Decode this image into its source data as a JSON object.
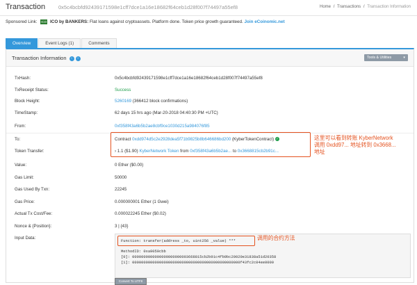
{
  "header": {
    "title": "Transaction",
    "hash": "0x5c4bcbfd92439171598e1cff7dce1a16e18682f64ceb1d28f007f74497a55ef8",
    "breadcrumbs": [
      "Home",
      "Transactions",
      "Transaction Information"
    ],
    "separator": "/"
  },
  "sponsor": {
    "prefix": "Sponsored Link:",
    "logo_text": "ICO",
    "brand": "ICO by BANKERS:",
    "text": "Flat loans against cryptoassets. Platform done. Token price growth guaranteed.",
    "link": "Join eCoinomic.net"
  },
  "tabs": [
    {
      "label": "Overview",
      "active": true
    },
    {
      "label": "Event Logs (1)",
      "active": false
    },
    {
      "label": "Comments",
      "active": false
    }
  ],
  "panel": {
    "title": "Transaction Information",
    "tools_label": "Tools & Utilities",
    "caret": "▾",
    "prev_icon": "‹",
    "next_icon": "›"
  },
  "fields": {
    "txhash": {
      "label": "TxHash:",
      "value": "0x5c4bcbfd92439171598e1cff7dce1a16e18682f64ceb1d28f007f74497a55ef8"
    },
    "receipt": {
      "label": "TxReceipt Status:",
      "value": "Success"
    },
    "block": {
      "label": "Block Height:",
      "value": "5260169",
      "extra": "(366412 block confirmations)"
    },
    "timestamp": {
      "label": "TimeStamp:",
      "value": "62 days 15 hrs ago (Mar-20-2018 04:40:30 PM +UTC)"
    },
    "from": {
      "label": "From:",
      "value": "0xf358f43a6b5b2ae8cbf9ce1030d215a984076f85"
    },
    "to": {
      "label": "To:",
      "prefix": "Contract",
      "value": "0xdd974d5c2e2928dea5f71b9825b8b646686bd200",
      "tag": "(KyberTokenContract)",
      "check": "✓"
    },
    "token_transfer": {
      "label": "Token Transfer:",
      "amount": "› 1.1 ($1.90)",
      "token": "KyberNetwork Token",
      "from_word": "from",
      "from": "0xf358f43a6b5b2ae...",
      "to_word": "to",
      "to": "0x3668815cb2b91c..."
    },
    "value": {
      "label": "Value:",
      "value": "0 Ether ($0.00)"
    },
    "gas_limit": {
      "label": "Gas Limit:",
      "value": "50000"
    },
    "gas_used": {
      "label": "Gas Used By Txn:",
      "value": "22245"
    },
    "gas_price": {
      "label": "Gas Price:",
      "value": "0.000000001 Ether (1 Gwei)"
    },
    "fee": {
      "label": "Actual Tx Cost/Fee:",
      "value": "0.000022245 Ether ($0.02)"
    },
    "nonce": {
      "label": "Nonce & {Position}:",
      "value": "3 | {43}"
    },
    "input": {
      "label": "Input Data:",
      "function": "Function: transfer(address _to, uint256 _value) ***",
      "method_id": "MethodID: 0xa9059cbb",
      "param0": "[0]:  0000000000000000000000003668815cb2b91c4fb9bc20020e31838a51d20358",
      "param1": "[1]:  000000000000000000000000000000000000000000000000f43fc2c04ee0000",
      "switch_label": "Convert To UTF8"
    }
  },
  "annotations": {
    "transfer_note_1": "这里可以看到转账 KyberNetwork",
    "transfer_note_2": "调用 0xdd97... 地址转到 0x3668...",
    "transfer_note_3": "地址",
    "function_note": "调用的合约方法"
  },
  "colors": {
    "accent": "#3498db",
    "success": "#1e9e4a",
    "annotation": "#e4521f"
  }
}
